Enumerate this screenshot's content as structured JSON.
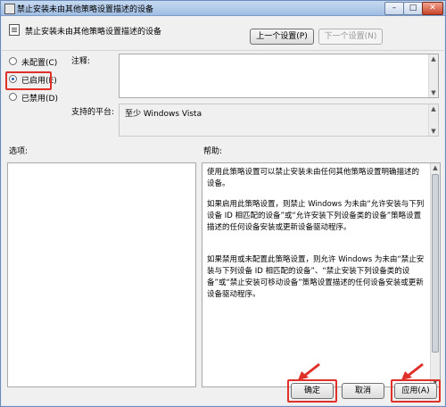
{
  "window": {
    "title": "禁止安装未由其他策略设置描述的设备",
    "minimize": "–",
    "maximize": "□",
    "close": "✕"
  },
  "header": {
    "policy_title": "禁止安装未由其他策略设置描述的设备",
    "prev_button": "上一个设置(P)",
    "next_button": "下一个设置(N)"
  },
  "radios": [
    {
      "label": "未配置(C)",
      "checked": false
    },
    {
      "label": "已启用(E)",
      "checked": true
    },
    {
      "label": "已禁用(D)",
      "checked": false
    }
  ],
  "comment_label": "注释:",
  "platform_label": "支持的平台:",
  "platform_value": "至少 Windows Vista",
  "options_label": "选项:",
  "help_label": "帮助:",
  "help_paragraphs": [
    "使用此策略设置可以禁止安装未由任何其他策略设置明确描述的设备。",
    "如果启用此策略设置，则禁止 Windows 为未由“允许安装与下列设备 ID 相匹配的设备”或“允许安装下列设备类的设备”策略设置描述的任何设备安装或更新设备驱动程序。",
    "如果禁用或未配置此策略设置，则允许 Windows 为未由“禁止安装与下列设备 ID 相匹配的设备”、“禁止安装下列设备类的设备”或“禁止安装可移动设备”策略设置描述的任何设备安装或更新设备驱动程序。"
  ],
  "footer": {
    "ok": "确定",
    "cancel": "取消",
    "apply": "应用(A)"
  },
  "colors": {
    "highlight": "#e0302a"
  }
}
